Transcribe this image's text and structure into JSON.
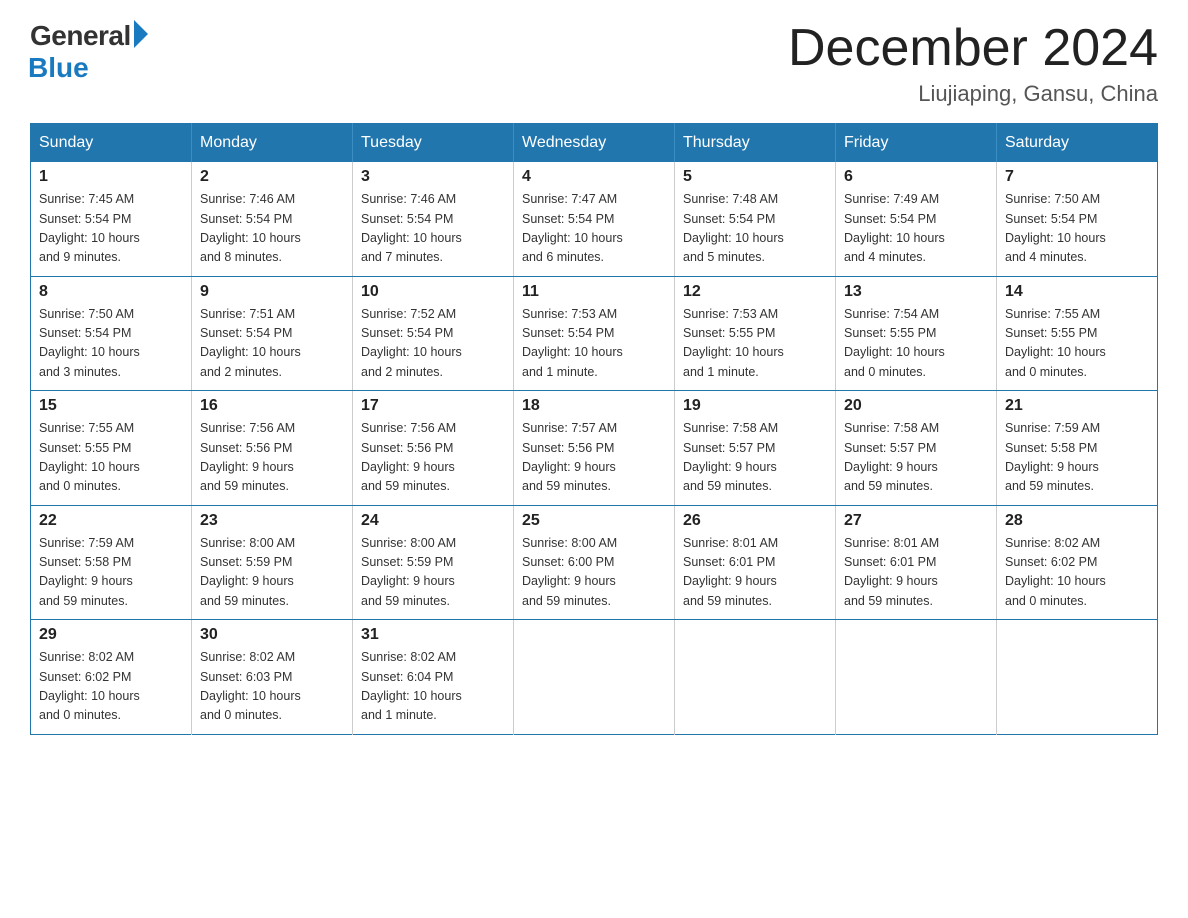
{
  "logo": {
    "general": "General",
    "blue": "Blue"
  },
  "title": "December 2024",
  "location": "Liujiaping, Gansu, China",
  "days_of_week": [
    "Sunday",
    "Monday",
    "Tuesday",
    "Wednesday",
    "Thursday",
    "Friday",
    "Saturday"
  ],
  "weeks": [
    [
      {
        "day": "1",
        "info": "Sunrise: 7:45 AM\nSunset: 5:54 PM\nDaylight: 10 hours\nand 9 minutes."
      },
      {
        "day": "2",
        "info": "Sunrise: 7:46 AM\nSunset: 5:54 PM\nDaylight: 10 hours\nand 8 minutes."
      },
      {
        "day": "3",
        "info": "Sunrise: 7:46 AM\nSunset: 5:54 PM\nDaylight: 10 hours\nand 7 minutes."
      },
      {
        "day": "4",
        "info": "Sunrise: 7:47 AM\nSunset: 5:54 PM\nDaylight: 10 hours\nand 6 minutes."
      },
      {
        "day": "5",
        "info": "Sunrise: 7:48 AM\nSunset: 5:54 PM\nDaylight: 10 hours\nand 5 minutes."
      },
      {
        "day": "6",
        "info": "Sunrise: 7:49 AM\nSunset: 5:54 PM\nDaylight: 10 hours\nand 4 minutes."
      },
      {
        "day": "7",
        "info": "Sunrise: 7:50 AM\nSunset: 5:54 PM\nDaylight: 10 hours\nand 4 minutes."
      }
    ],
    [
      {
        "day": "8",
        "info": "Sunrise: 7:50 AM\nSunset: 5:54 PM\nDaylight: 10 hours\nand 3 minutes."
      },
      {
        "day": "9",
        "info": "Sunrise: 7:51 AM\nSunset: 5:54 PM\nDaylight: 10 hours\nand 2 minutes."
      },
      {
        "day": "10",
        "info": "Sunrise: 7:52 AM\nSunset: 5:54 PM\nDaylight: 10 hours\nand 2 minutes."
      },
      {
        "day": "11",
        "info": "Sunrise: 7:53 AM\nSunset: 5:54 PM\nDaylight: 10 hours\nand 1 minute."
      },
      {
        "day": "12",
        "info": "Sunrise: 7:53 AM\nSunset: 5:55 PM\nDaylight: 10 hours\nand 1 minute."
      },
      {
        "day": "13",
        "info": "Sunrise: 7:54 AM\nSunset: 5:55 PM\nDaylight: 10 hours\nand 0 minutes."
      },
      {
        "day": "14",
        "info": "Sunrise: 7:55 AM\nSunset: 5:55 PM\nDaylight: 10 hours\nand 0 minutes."
      }
    ],
    [
      {
        "day": "15",
        "info": "Sunrise: 7:55 AM\nSunset: 5:55 PM\nDaylight: 10 hours\nand 0 minutes."
      },
      {
        "day": "16",
        "info": "Sunrise: 7:56 AM\nSunset: 5:56 PM\nDaylight: 9 hours\nand 59 minutes."
      },
      {
        "day": "17",
        "info": "Sunrise: 7:56 AM\nSunset: 5:56 PM\nDaylight: 9 hours\nand 59 minutes."
      },
      {
        "day": "18",
        "info": "Sunrise: 7:57 AM\nSunset: 5:56 PM\nDaylight: 9 hours\nand 59 minutes."
      },
      {
        "day": "19",
        "info": "Sunrise: 7:58 AM\nSunset: 5:57 PM\nDaylight: 9 hours\nand 59 minutes."
      },
      {
        "day": "20",
        "info": "Sunrise: 7:58 AM\nSunset: 5:57 PM\nDaylight: 9 hours\nand 59 minutes."
      },
      {
        "day": "21",
        "info": "Sunrise: 7:59 AM\nSunset: 5:58 PM\nDaylight: 9 hours\nand 59 minutes."
      }
    ],
    [
      {
        "day": "22",
        "info": "Sunrise: 7:59 AM\nSunset: 5:58 PM\nDaylight: 9 hours\nand 59 minutes."
      },
      {
        "day": "23",
        "info": "Sunrise: 8:00 AM\nSunset: 5:59 PM\nDaylight: 9 hours\nand 59 minutes."
      },
      {
        "day": "24",
        "info": "Sunrise: 8:00 AM\nSunset: 5:59 PM\nDaylight: 9 hours\nand 59 minutes."
      },
      {
        "day": "25",
        "info": "Sunrise: 8:00 AM\nSunset: 6:00 PM\nDaylight: 9 hours\nand 59 minutes."
      },
      {
        "day": "26",
        "info": "Sunrise: 8:01 AM\nSunset: 6:01 PM\nDaylight: 9 hours\nand 59 minutes."
      },
      {
        "day": "27",
        "info": "Sunrise: 8:01 AM\nSunset: 6:01 PM\nDaylight: 9 hours\nand 59 minutes."
      },
      {
        "day": "28",
        "info": "Sunrise: 8:02 AM\nSunset: 6:02 PM\nDaylight: 10 hours\nand 0 minutes."
      }
    ],
    [
      {
        "day": "29",
        "info": "Sunrise: 8:02 AM\nSunset: 6:02 PM\nDaylight: 10 hours\nand 0 minutes."
      },
      {
        "day": "30",
        "info": "Sunrise: 8:02 AM\nSunset: 6:03 PM\nDaylight: 10 hours\nand 0 minutes."
      },
      {
        "day": "31",
        "info": "Sunrise: 8:02 AM\nSunset: 6:04 PM\nDaylight: 10 hours\nand 1 minute."
      },
      {
        "day": "",
        "info": ""
      },
      {
        "day": "",
        "info": ""
      },
      {
        "day": "",
        "info": ""
      },
      {
        "day": "",
        "info": ""
      }
    ]
  ]
}
